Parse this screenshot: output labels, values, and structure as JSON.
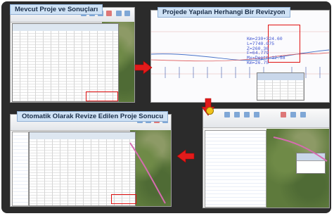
{
  "panels": {
    "top_left": {
      "caption": "Mevcut Proje ve Sonuçları"
    },
    "top_right": {
      "caption": "Projede Yapılan Herhangi Bir Revizyon",
      "readout_lines": [
        "Km=230+324.60",
        "L=7740.075",
        "Z=260.36",
        "F=64.779",
        "Mx=Depth=12.58",
        "Km=26.75"
      ]
    },
    "bottom_left": {
      "caption": "Otomatik Olarak Revize Edilen Proje Sonucu"
    },
    "bottom_right": {
      "caption": ""
    }
  },
  "arrows": [
    "right-arrow",
    "down-arrow",
    "left-arrow"
  ],
  "colors": {
    "highlight": "#e01010",
    "arrow": "#e21b1b",
    "caption_bg": "#cfe2f5"
  }
}
